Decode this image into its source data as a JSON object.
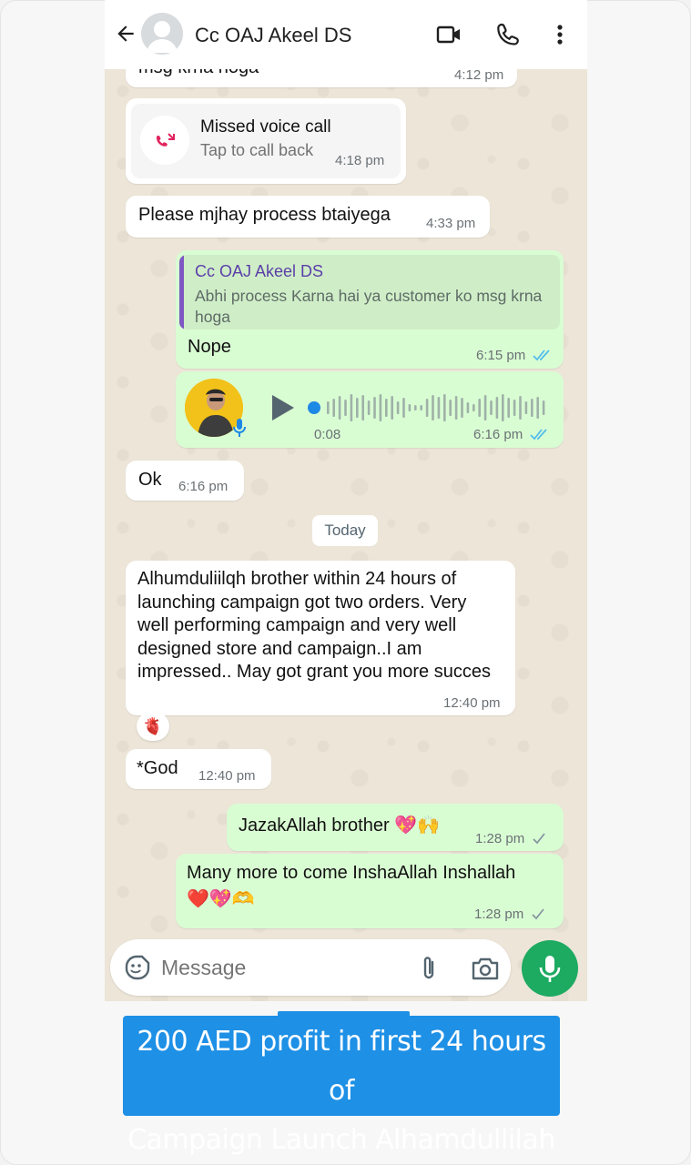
{
  "header": {
    "contact_name": "Cc OAJ Akeel DS"
  },
  "messages": {
    "partial_text": "msg krna hoga",
    "partial_time": "4:12 pm",
    "missed_call_title": "Missed voice call",
    "missed_call_sub": "Tap to call back",
    "missed_call_time": "4:18 pm",
    "process_text": "Please mjhay process btaiyega",
    "process_time": "4:33 pm",
    "quote_author": "Cc OAJ Akeel DS",
    "quote_text": "Abhi process Karna hai ya customer ko msg krna hoga",
    "nope_text": "Nope",
    "nope_time": "6:15 pm",
    "voice_duration": "0:08",
    "voice_time": "6:16 pm",
    "ok_text": "Ok",
    "ok_time": "6:16 pm",
    "date_divider": "Today",
    "long_text": "Alhumduliilqh brother within 24 hours of launching campaign got two orders. Very well performing campaign and very well designed store and campaign..I am impressed.. May got grant you more succes",
    "long_time": "12:40 pm",
    "reaction": "🫀",
    "god_text": "*God",
    "god_time": "12:40 pm",
    "jazak_text": "JazakAllah brother 💖🙌",
    "jazak_time": "1:28 pm",
    "more_text_line1": "Many more to come InshaAllah Inshallah",
    "more_text_line2": "❤️💖🫶",
    "more_time": "1:28 pm"
  },
  "composer": {
    "placeholder": "Message"
  },
  "caption": {
    "line1": "200 AED profit in first 24 hours of",
    "line2": "Campaign Launch Alhamdullilah"
  },
  "colors": {
    "outgoing_bubble": "#d9fdd3",
    "incoming_bubble": "#ffffff",
    "mic_button": "#1daa61",
    "read_ticks": "#53bdeb",
    "quote_bar": "#7e57c2",
    "caption_bg": "#1e90e6"
  },
  "icons": {
    "back": "arrow-left-icon",
    "video": "video-call-icon",
    "call": "phone-icon",
    "menu": "more-vertical-icon",
    "missed": "missed-call-icon",
    "play": "play-icon",
    "sticker": "sticker-icon",
    "attach": "paperclip-icon",
    "camera": "camera-icon",
    "mic": "mic-icon"
  }
}
